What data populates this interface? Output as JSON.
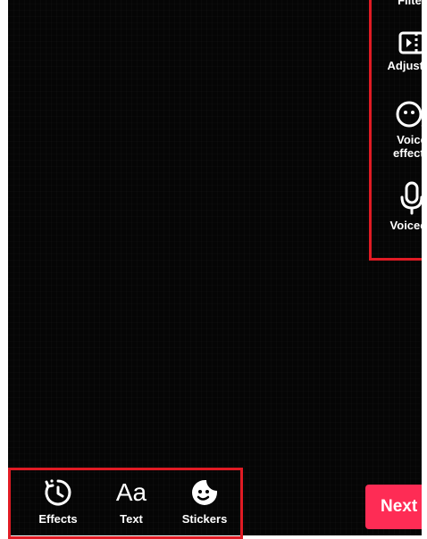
{
  "right_rail": {
    "items": [
      {
        "label": "Filter",
        "icon": "filter-icon"
      },
      {
        "label": "Adjust cl",
        "icon": "adjust-clips-icon"
      },
      {
        "label": "Voice\neffects",
        "icon": "voice-effects-icon"
      },
      {
        "label": "Voiceov",
        "icon": "microphone-icon"
      }
    ]
  },
  "bottom_tools": [
    {
      "label": "Effects",
      "icon": "effects-timer-icon"
    },
    {
      "label": "Text",
      "icon": "text-aa-icon",
      "glyph": "Aa"
    },
    {
      "label": "Stickers",
      "icon": "sticker-icon"
    }
  ],
  "next_button": {
    "label": "Next"
  },
  "colors": {
    "highlight": "#e01b24",
    "accent": "#fe2c55",
    "background": "#050505",
    "text": "#ffffff"
  }
}
